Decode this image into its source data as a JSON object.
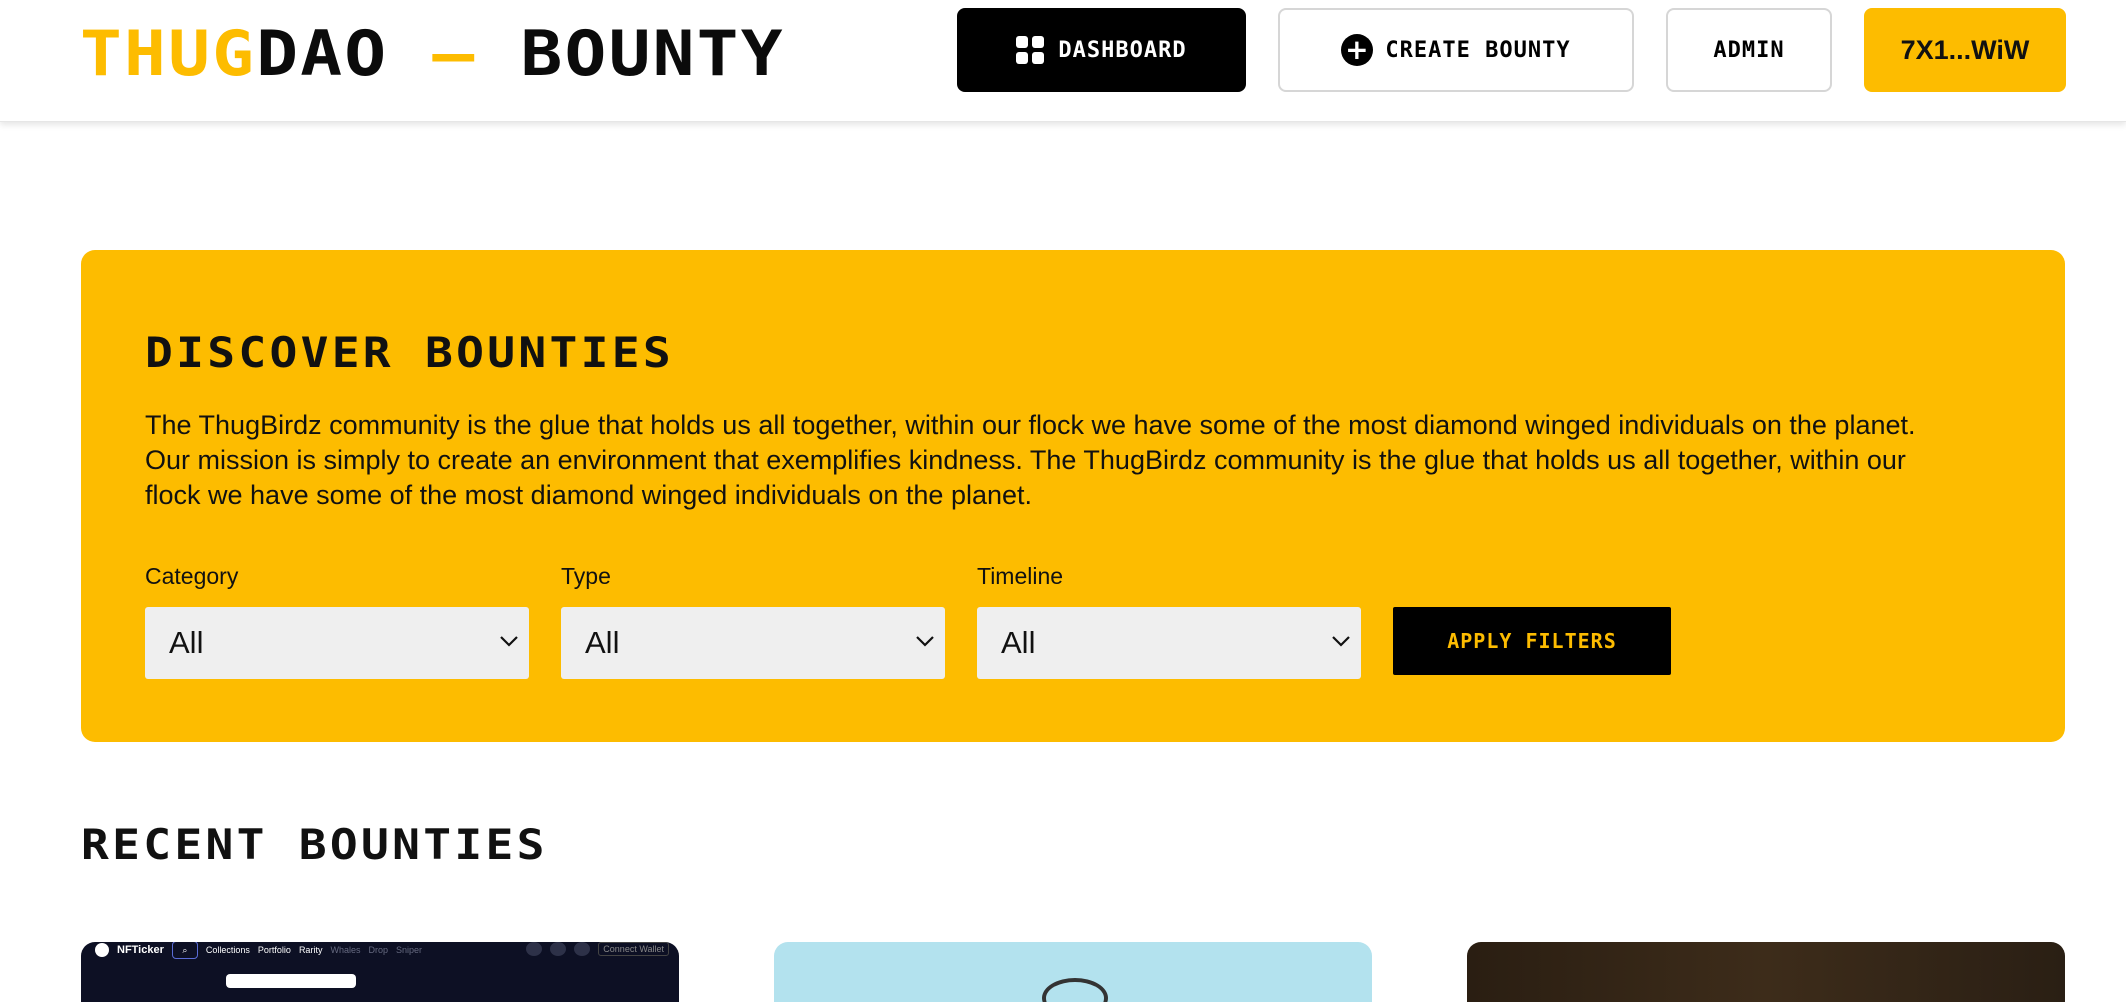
{
  "header": {
    "logo": {
      "part1": "THUG",
      "part2": "DAO",
      "part3": " — ",
      "part4": "BOUNTY"
    },
    "nav": {
      "dashboard_label": "DASHBOARD",
      "create_bounty_label": "CREATE BOUNTY",
      "admin_label": "ADMIN",
      "wallet_label": "7X1...WiW"
    }
  },
  "discover": {
    "title": "DISCOVER BOUNTIES",
    "description": "The ThugBirdz community is the glue that holds us all together, within our flock we have some of the most diamond winged individuals on the planet. Our mission is simply to create an environment that exemplifies kindness. The ThugBirdz community is the glue that holds us all together, within our flock we have some of the most diamond winged individuals on the planet.",
    "filters": {
      "category": {
        "label": "Category",
        "value": "All"
      },
      "type": {
        "label": "Type",
        "value": "All"
      },
      "timeline": {
        "label": "Timeline",
        "value": "All"
      }
    },
    "apply_label": "APPLY FILTERS"
  },
  "recent": {
    "title": "RECENT BOUNTIES",
    "card1_preview": {
      "brand": "NFTicker",
      "links": [
        "Collections",
        "Portfolio",
        "Rarity",
        "Whales",
        "Drop",
        "Sniper"
      ],
      "connect": "Connect Wallet"
    }
  },
  "colors": {
    "accent": "#fdbc00",
    "dark": "#000000",
    "select_bg": "#efefef"
  }
}
